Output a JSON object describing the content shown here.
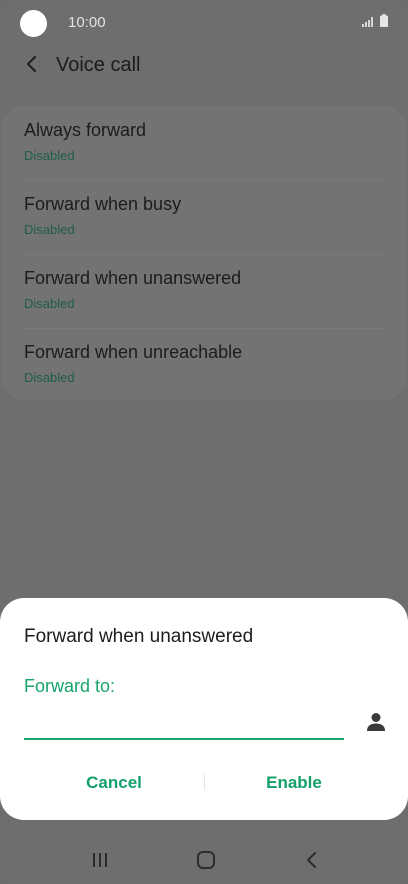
{
  "status_bar": {
    "time": "10:00"
  },
  "header": {
    "title": "Voice call"
  },
  "list": [
    {
      "title": "Always forward",
      "status": "Disabled"
    },
    {
      "title": "Forward when busy",
      "status": "Disabled"
    },
    {
      "title": "Forward when unanswered",
      "status": "Disabled"
    },
    {
      "title": "Forward when unreachable",
      "status": "Disabled"
    }
  ],
  "dialog": {
    "title": "Forward when unanswered",
    "field_label": "Forward to:",
    "field_value": "",
    "cancel_label": "Cancel",
    "enable_label": "Enable"
  },
  "colors": {
    "accent": "#18a36a",
    "dialog_bg": "#ffffff",
    "overlay": "#6e6e6e"
  },
  "icons": [
    "camera-cutout",
    "signal-icon",
    "battery-icon",
    "back-arrow-icon",
    "contact-icon",
    "recents-icon",
    "home-icon",
    "nav-back-icon"
  ]
}
